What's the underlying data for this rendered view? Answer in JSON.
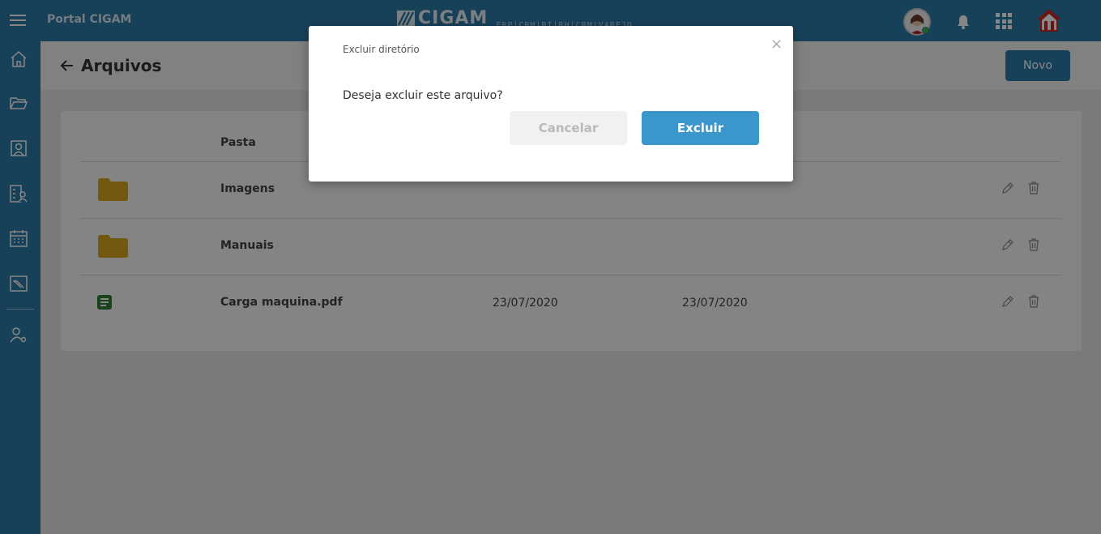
{
  "app": {
    "title": "Portal CIGAM",
    "logo_text": "CIGAM",
    "logo_sub": "ERP|CRM|BI|RH|CRM|VAREJO"
  },
  "header": {
    "icons": [
      "menu-icon",
      "avatar",
      "bell-icon",
      "apps-grid-icon",
      "home-logo-icon"
    ]
  },
  "sidebar": {
    "items": [
      {
        "icon": "home-icon"
      },
      {
        "icon": "folder-open-icon"
      },
      {
        "icon": "badge-icon"
      },
      {
        "icon": "user-list-icon"
      },
      {
        "icon": "calendar-icon"
      },
      {
        "icon": "ticket-icon"
      },
      {
        "icon": "user-settings-icon"
      }
    ]
  },
  "page": {
    "title": "Arquivos",
    "new_button": "Novo"
  },
  "table": {
    "column_header": "Pasta",
    "rows": [
      {
        "type": "folder",
        "name": "Imagens",
        "created": "",
        "modified": ""
      },
      {
        "type": "folder",
        "name": "Manuais",
        "created": "",
        "modified": ""
      },
      {
        "type": "file",
        "name": "Carga maquina.pdf",
        "created": "23/07/2020",
        "modified": "23/07/2020"
      }
    ]
  },
  "modal": {
    "title": "Excluir diretório",
    "close": "×",
    "message": "Deseja excluir este arquivo?",
    "cancel_label": "Cancelar",
    "confirm_label": "Excluir"
  },
  "colors": {
    "primary": "#2c7ca9",
    "button_blue": "#3b96cc",
    "folder": "#d9a81f",
    "file": "#2e7d32"
  }
}
